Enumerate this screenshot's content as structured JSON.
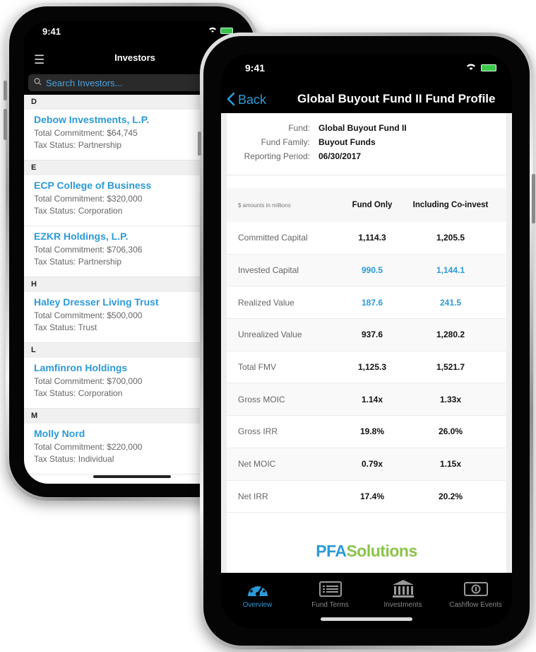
{
  "colors": {
    "accent": "#2b9ad6",
    "logo_green": "#8bc34a"
  },
  "back_phone": {
    "status_time": "9:41",
    "nav_title": "Investors",
    "search_placeholder": "Search Investors...",
    "sections": [
      {
        "letter": "D",
        "items": [
          {
            "name": "Debow Investments, L.P.",
            "commitment": "Total Commitment: $64,745",
            "tax": "Tax Status: Partnership"
          }
        ]
      },
      {
        "letter": "E",
        "items": [
          {
            "name": "ECP College of Business",
            "commitment": "Total Commitment: $320,000",
            "tax": "Tax Status: Corporation"
          },
          {
            "name": "EZKR Holdings, L.P.",
            "commitment": "Total Commitment: $706,306",
            "tax": "Tax Status: Partnership"
          }
        ]
      },
      {
        "letter": "H",
        "items": [
          {
            "name": "Haley Dresser Living Trust",
            "commitment": "Total Commitment: $500,000",
            "tax": "Tax Status: Trust"
          }
        ]
      },
      {
        "letter": "L",
        "items": [
          {
            "name": "Lamfinron Holdings",
            "commitment": "Total Commitment: $700,000",
            "tax": "Tax Status: Corporation"
          }
        ]
      },
      {
        "letter": "M",
        "items": [
          {
            "name": "Molly Nord",
            "commitment": "Total Commitment: $220,000",
            "tax": "Tax Status: Individual"
          }
        ]
      }
    ]
  },
  "front_phone": {
    "status_time": "9:41",
    "back_label": "Back",
    "nav_title": "Global Buyout Fund II Fund Profile",
    "fund_info": [
      {
        "label": "Fund:",
        "value": "Global Buyout Fund II"
      },
      {
        "label": "Fund Family:",
        "value": "Buyout Funds"
      },
      {
        "label": "Reporting Period:",
        "value": "06/30/2017"
      }
    ],
    "table": {
      "note": "$ amounts in millions",
      "col1": "Fund Only",
      "col2": "Including Co-invest",
      "rows": [
        {
          "label": "Committed Capital",
          "fund": "1,114.3",
          "coinvest": "1,205.5",
          "link": false
        },
        {
          "label": "Invested Capital",
          "fund": "990.5",
          "coinvest": "1,144.1",
          "link": true
        },
        {
          "label": "Realized Value",
          "fund": "187.6",
          "coinvest": "241.5",
          "link": true
        },
        {
          "label": "Unrealized Value",
          "fund": "937.6",
          "coinvest": "1,280.2",
          "link": false
        },
        {
          "label": "Total FMV",
          "fund": "1,125.3",
          "coinvest": "1,521.7",
          "link": false
        },
        {
          "label": "Gross MOIC",
          "fund": "1.14x",
          "coinvest": "1.33x",
          "link": false
        },
        {
          "label": "Gross IRR",
          "fund": "19.8%",
          "coinvest": "26.0%",
          "link": false
        },
        {
          "label": "Net MOIC",
          "fund": "0.79x",
          "coinvest": "1.15x",
          "link": false
        },
        {
          "label": "Net IRR",
          "fund": "17.4%",
          "coinvest": "20.2%",
          "link": false
        }
      ]
    },
    "logo": {
      "part1": "PFA",
      "part2": "Solutions"
    },
    "tabs": [
      {
        "label": "Overview",
        "icon": "gauge-icon",
        "active": true
      },
      {
        "label": "Fund Terms",
        "icon": "list-icon",
        "active": false
      },
      {
        "label": "Investments",
        "icon": "bank-icon",
        "active": false
      },
      {
        "label": "Cashflow Events",
        "icon": "cash-icon",
        "active": false
      }
    ]
  }
}
